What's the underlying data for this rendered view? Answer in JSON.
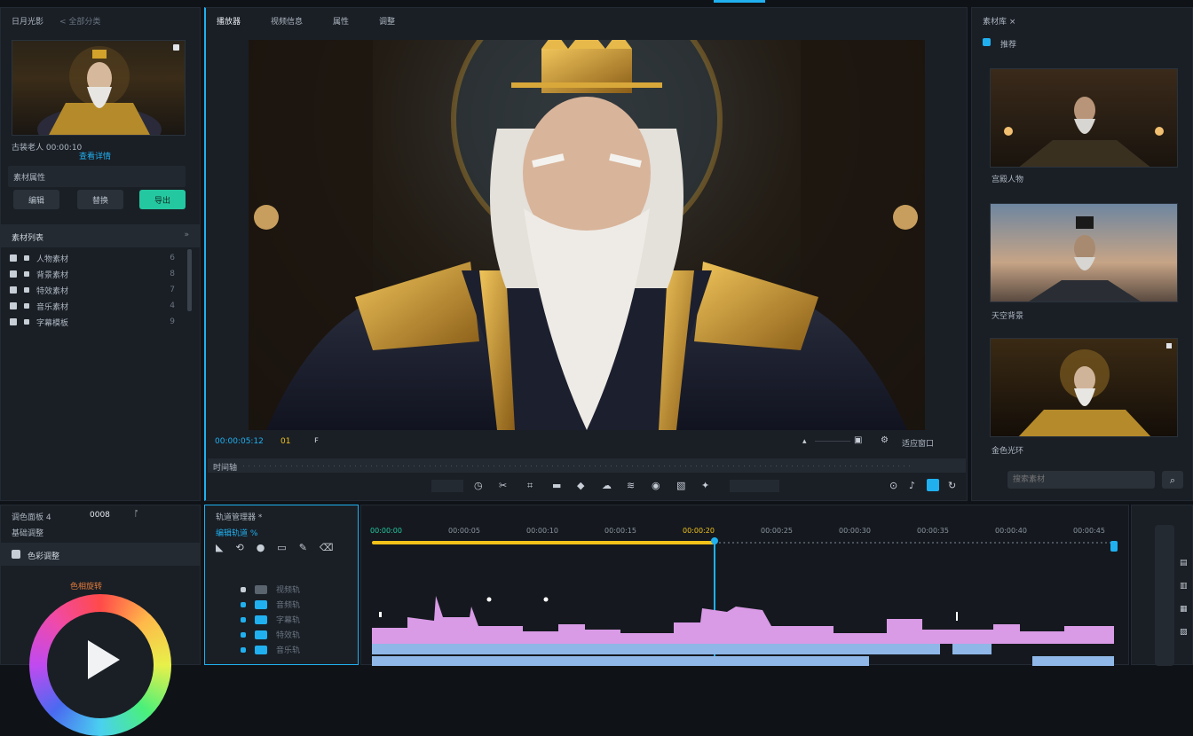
{
  "top_left": {
    "title": "日月光影",
    "menu": "< 全部分类"
  },
  "preview_tabs": [
    "播放器",
    "视频信息",
    "属性",
    "调整"
  ],
  "left_panel": {
    "media_caption": "古装老人 00:00:10",
    "caption_link": "查看详情",
    "section_label": "素材属性",
    "buttons": [
      "编辑",
      "替换",
      "导出"
    ],
    "list_title": "素材列表",
    "list_items": [
      {
        "label": "人物素材",
        "count": "6"
      },
      {
        "label": "背景素材",
        "count": "8"
      },
      {
        "label": "特效素材",
        "count": "7"
      },
      {
        "label": "音乐素材",
        "count": "4"
      },
      {
        "label": "字幕模板",
        "count": "9"
      }
    ]
  },
  "viewer": {
    "timecode": "00:00:05:12",
    "marker": "01",
    "fit_label": "适应窗口",
    "scrub_label": "时间轴"
  },
  "right_panel": {
    "title": "素材库 ×",
    "sub": "推荐",
    "thumbs": [
      {
        "caption": "宫殿人物"
      },
      {
        "caption": "天空背景"
      },
      {
        "caption": "金色光环"
      }
    ],
    "search_placeholder": "搜索素材"
  },
  "bottom_left": {
    "title": "调色面板 4",
    "counter": "0008",
    "sub": "基础调整",
    "section": "色彩调整",
    "label": "色相旋转"
  },
  "track_panel": {
    "title": "轨道管理器 *",
    "sub": "编辑轨道 %",
    "rows": [
      "视频轨",
      "音频轨",
      "字幕轨",
      "特效轨",
      "音乐轨"
    ]
  },
  "timeline": {
    "ruler": [
      "00:00:00",
      "00:00:05",
      "00:00:10",
      "00:00:15",
      "00:00:20",
      "00:00:25",
      "00:00:30",
      "00:00:35",
      "00:00:40",
      "00:00:45"
    ]
  },
  "colors": {
    "accent": "#20b0f0",
    "green": "#24c8a0",
    "yellow": "#f2c21a",
    "pink": "#d99ae6",
    "blue": "#8fb7e8"
  }
}
